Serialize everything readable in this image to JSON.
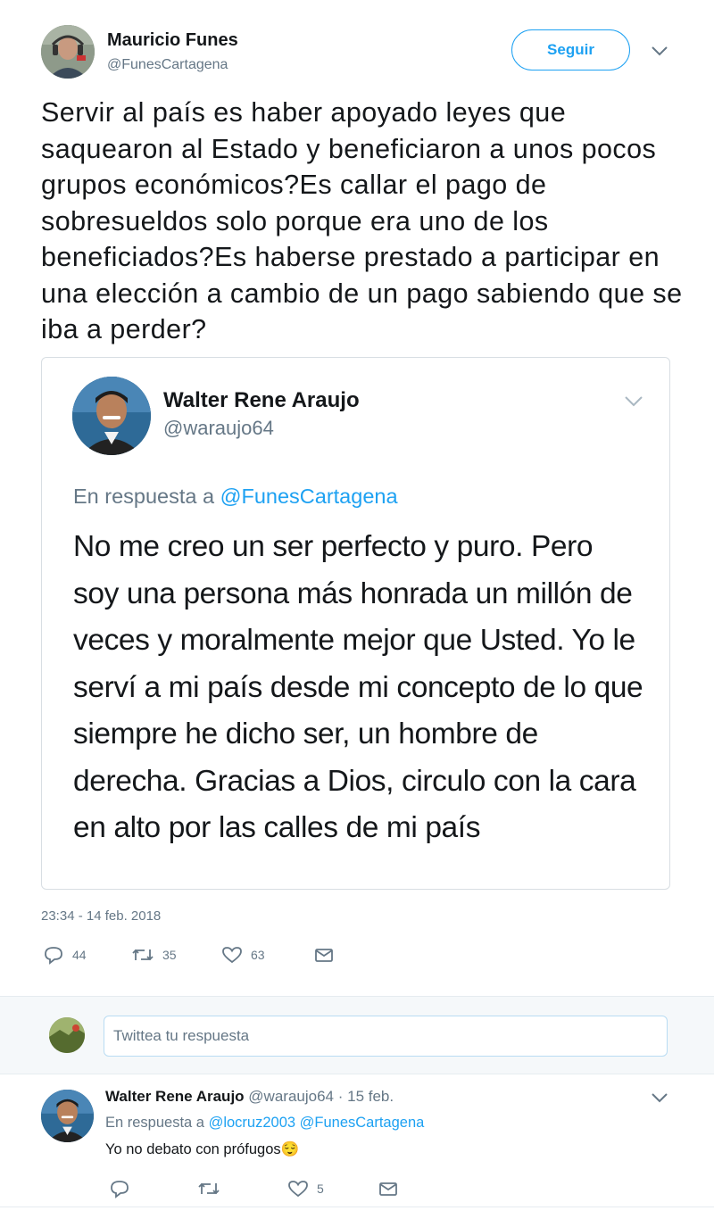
{
  "tweet": {
    "author_name": "Mauricio Funes",
    "author_handle": "@FunesCartagena",
    "follow_label": "Seguir",
    "text": "Servir al país es haber apoyado leyes que saquearon al Estado y beneficiaron a unos pocos grupos económicos?Es callar el pago de sobresueldos solo porque era uno de los beneficiados?Es haberse prestado a participar en una elección a cambio de un pago sabiendo que se iba a perder?",
    "timestamp": "23:34 - 14 feb. 2018",
    "stats": {
      "replies": "44",
      "retweets": "35",
      "likes": "63"
    }
  },
  "quoted": {
    "author_name": "Walter Rene Araujo",
    "author_handle": "@waraujo64",
    "reply_prefix": "En respuesta a ",
    "reply_mention": "@FunesCartagena",
    "text": "No me creo un ser perfecto y puro. Pero soy una persona más honrada un millón de veces y moralmente mejor que Usted. Yo le serví a mi país desde mi concepto de lo que siempre he dicho ser, un hombre de derecha. Gracias a Dios, circulo con la cara en alto por las calles de mi país"
  },
  "reply_box": {
    "placeholder": "Twittea tu respuesta"
  },
  "reply": {
    "author_name": "Walter Rene Araujo",
    "author_handle": "@waraujo64",
    "date": "· 15 feb.",
    "reply_prefix": "En respuesta a ",
    "mention_1": "@locruz2003",
    "mention_2": "@FunesCartagena",
    "text": "Yo no debato con prófugos",
    "emoji": "😌",
    "stats": {
      "likes": "5"
    }
  },
  "icons": [
    "reply-icon",
    "retweet-icon",
    "like-icon",
    "message-icon",
    "chevron-down-icon"
  ],
  "colors": {
    "accent": "#1da1f2",
    "muted": "#657786",
    "text": "#14171a",
    "border": "#e6ecf0"
  }
}
